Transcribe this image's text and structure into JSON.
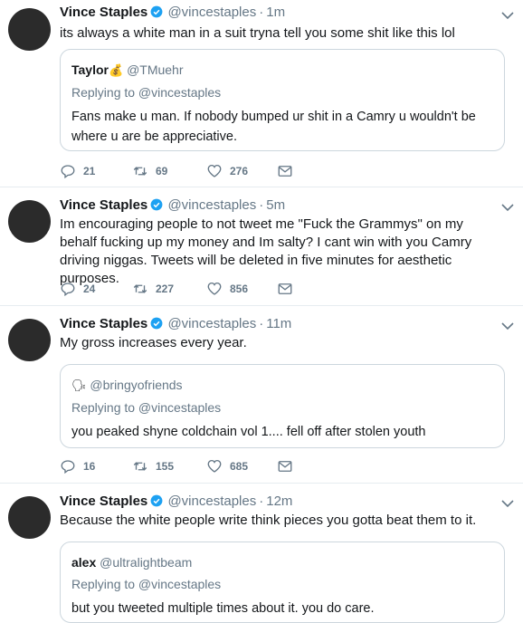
{
  "tweets": [
    {
      "name": "Vince Staples",
      "handle": "@vincestaples",
      "time": "1m",
      "text": "its always a white man in a suit tryna tell you some shit like this lol",
      "quote": {
        "name": "Taylor",
        "emoji": "💰",
        "handle": "@TMuehr",
        "replying": "Replying to @vincestaples",
        "text": "Fans make u man. If nobody bumped ur shit in a Camry u wouldn't be where u are be appreciative."
      },
      "replies": "21",
      "retweets": "69",
      "likes": "276"
    },
    {
      "name": "Vince Staples",
      "handle": "@vincestaples",
      "time": "5m",
      "text": "Im encouraging people to not tweet me \"Fuck the Grammys\" on my behalf fucking up my money and Im salty? I cant win with you Camry driving niggas. Tweets will be deleted in five minutes for aesthetic purposes.",
      "replies": "24",
      "retweets": "227",
      "likes": "856"
    },
    {
      "name": "Vince Staples",
      "handle": "@vincestaples",
      "time": "11m",
      "text": "My gross increases every year.",
      "quote": {
        "name": "",
        "emoji": "🗣",
        "handle": "@bringyofriends",
        "replying": "Replying to @vincestaples",
        "text": "you peaked shyne coldchain vol 1.... fell off after stolen youth"
      },
      "replies": "16",
      "retweets": "155",
      "likes": "685"
    },
    {
      "name": "Vince Staples",
      "handle": "@vincestaples",
      "time": "12m",
      "text": "Because the white people write think pieces you gotta beat them to it.",
      "quote": {
        "name": "alex",
        "handle": "@ultralightbeam",
        "replying": "Replying to @vincestaples",
        "text": "but you tweeted multiple times about it. you do care."
      }
    }
  ],
  "separator": "·",
  "colors": {
    "verified": "#1da1f2",
    "muted": "#657786",
    "border": "#e6ecf0",
    "avatar": "#2b2b2b"
  }
}
